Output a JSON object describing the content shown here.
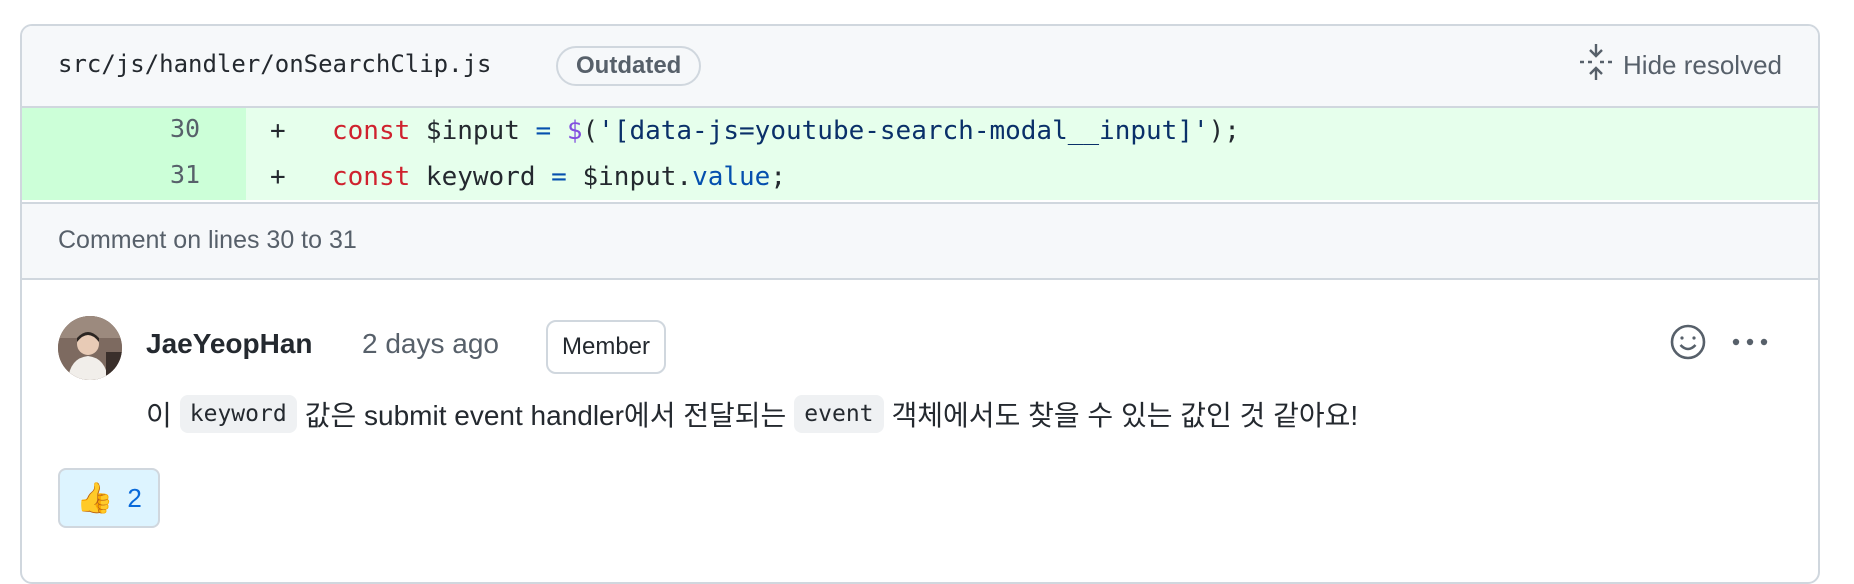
{
  "file": {
    "path": "src/js/handler/onSearchClip.js",
    "status_badge": "Outdated",
    "hide_resolved_label": "Hide resolved"
  },
  "diff": {
    "lines": [
      {
        "number": "30",
        "marker": "+",
        "tokens": [
          "const",
          " $input ",
          "=",
          " ",
          "$",
          "(",
          "'[data-js=youtube-search-modal__input]'",
          ");"
        ]
      },
      {
        "number": "31",
        "marker": "+",
        "tokens": [
          "const",
          " keyword ",
          "=",
          " $input.",
          "value",
          ";"
        ]
      }
    ]
  },
  "comment_context": "Comment on lines 30 to 31",
  "comment": {
    "author": "JaeYeopHan",
    "timestamp": "2 days ago",
    "role_badge": "Member",
    "body": {
      "part1": "이",
      "code1": "keyword",
      "part2": "값은 submit event handler에서 전달되는",
      "code2": "event",
      "part3": "객체에서도 찾을 수 있는 값인 것 같아요!"
    },
    "reaction": {
      "emoji": "👍",
      "icon": "thumbs-up-icon",
      "count": "2"
    }
  },
  "colors": {
    "added_line_bg": "#e6ffec",
    "added_gutter_bg": "#ccffd8",
    "keyword": "#cf222e",
    "string": "#0a3069",
    "border": "#d0d7de"
  }
}
